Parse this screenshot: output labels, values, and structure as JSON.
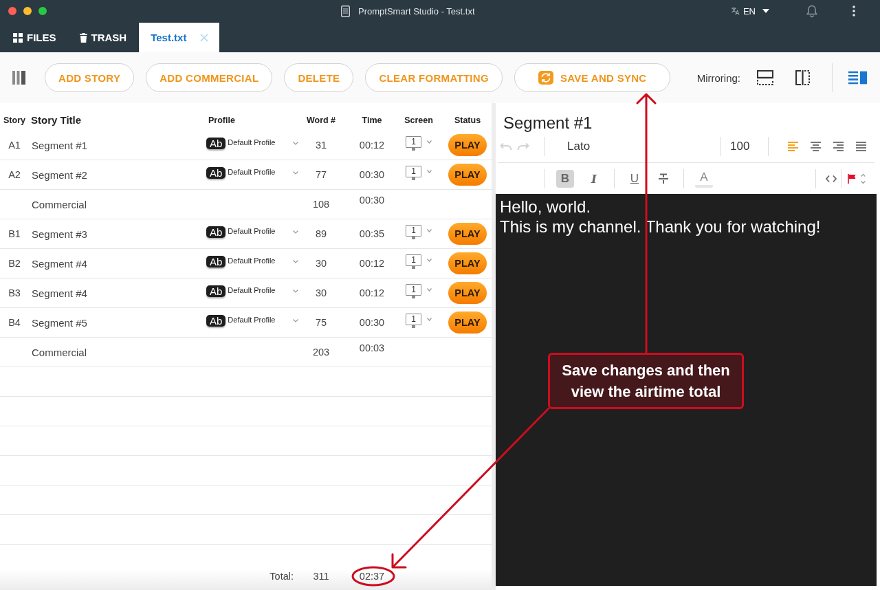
{
  "window": {
    "title": "PromptSmart Studio - Test.txt",
    "language": "EN"
  },
  "tabs": [
    {
      "kind": "files",
      "label": "FILES",
      "selected": false
    },
    {
      "kind": "trash",
      "label": "TRASH",
      "selected": false
    },
    {
      "kind": "document",
      "label": "Test.txt",
      "selected": true
    }
  ],
  "toolbar": {
    "buttons": [
      {
        "kind": "add_story",
        "label": "ADD STORY"
      },
      {
        "kind": "add_commercial",
        "label": "ADD COMMERCIAL"
      },
      {
        "kind": "delete",
        "label": "DELETE"
      },
      {
        "kind": "clear_formatting",
        "label": "CLEAR FORMATTING"
      },
      {
        "kind": "save_sync",
        "label": "SAVE AND SYNC"
      }
    ],
    "mirroring_label": "Mirroring:"
  },
  "table": {
    "columns": [
      "Story",
      "Story Title",
      "Profile",
      "Word #",
      "Time",
      "Screen",
      "Status"
    ],
    "rows": [
      {
        "kind": "story",
        "story": "A1",
        "title": "Segment #1",
        "profile_badge": "Ab",
        "profile": "Default Profile",
        "words": "31",
        "time": "00:12",
        "screen": "1",
        "status": "PLAY"
      },
      {
        "kind": "story",
        "story": "A2",
        "title": "Segment #2",
        "profile_badge": "Ab",
        "profile": "Default Profile",
        "words": "77",
        "time": "00:30",
        "screen": "1",
        "status": "PLAY"
      },
      {
        "kind": "commercial",
        "title": "Commercial",
        "words": "108",
        "time": "00:30"
      },
      {
        "kind": "story",
        "story": "B1",
        "title": "Segment #3",
        "profile_badge": "Ab",
        "profile": "Default Profile",
        "words": "89",
        "time": "00:35",
        "screen": "1",
        "status": "PLAY"
      },
      {
        "kind": "story",
        "story": "B2",
        "title": "Segment #4",
        "profile_badge": "Ab",
        "profile": "Default Profile",
        "words": "30",
        "time": "00:12",
        "screen": "1",
        "status": "PLAY"
      },
      {
        "kind": "story",
        "story": "B3",
        "title": "Segment #4",
        "profile_badge": "Ab",
        "profile": "Default Profile",
        "words": "30",
        "time": "00:12",
        "screen": "1",
        "status": "PLAY"
      },
      {
        "kind": "story",
        "story": "B4",
        "title": "Segment #5",
        "profile_badge": "Ab",
        "profile": "Default Profile",
        "words": "75",
        "time": "00:30",
        "screen": "1",
        "status": "PLAY"
      },
      {
        "kind": "commercial",
        "title": "Commercial",
        "words": "203",
        "time": "00:03"
      }
    ],
    "total": {
      "label": "Total:",
      "words": "311",
      "time": "02:37"
    }
  },
  "editor": {
    "title": "Segment #1",
    "history": [
      {
        "kind": "undo",
        "disabled": true
      },
      {
        "kind": "redo",
        "disabled": true
      }
    ],
    "font": "Lato",
    "size": "100",
    "alignments": [
      {
        "kind": "left",
        "selected": true
      },
      {
        "kind": "center",
        "selected": false
      },
      {
        "kind": "right",
        "selected": false
      },
      {
        "kind": "justify",
        "selected": false
      }
    ],
    "format_groups": [
      [
        {
          "kind": "bold",
          "glyph": "B",
          "selected": true
        },
        {
          "kind": "italic",
          "glyph": "I",
          "selected": false
        }
      ],
      [
        {
          "kind": "underline",
          "glyph": "U",
          "selected": false
        },
        {
          "kind": "strikethrough",
          "selected": false
        }
      ],
      [
        {
          "kind": "color",
          "glyph": "A"
        }
      ]
    ],
    "lines": [
      "Hello, world.",
      "This is my channel. Thank you for watching!"
    ]
  },
  "annotation": {
    "text": "Save changes and then view the airtime total"
  }
}
